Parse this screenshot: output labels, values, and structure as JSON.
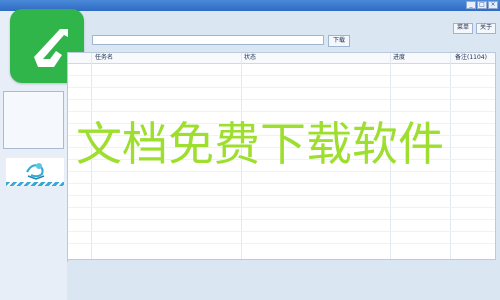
{
  "window": {
    "title_buttons": [
      "_",
      "□",
      "×"
    ]
  },
  "menubar": {
    "menu_label": "菜单",
    "about_label": "关于"
  },
  "download": {
    "url_value": "",
    "button_label": "下载"
  },
  "table": {
    "columns": [
      "任务名",
      "状态",
      "进度",
      "备注(1104)"
    ]
  },
  "watermark": {
    "text": "文档免费下载软件"
  },
  "colors": {
    "logo_green": "#2fb54a",
    "watermark_green": "#9dde2f",
    "titlebar_blue": "#2f6cc4"
  },
  "icons": {
    "logo": "app-logo-icon",
    "banner": "banner-figure-icon"
  }
}
